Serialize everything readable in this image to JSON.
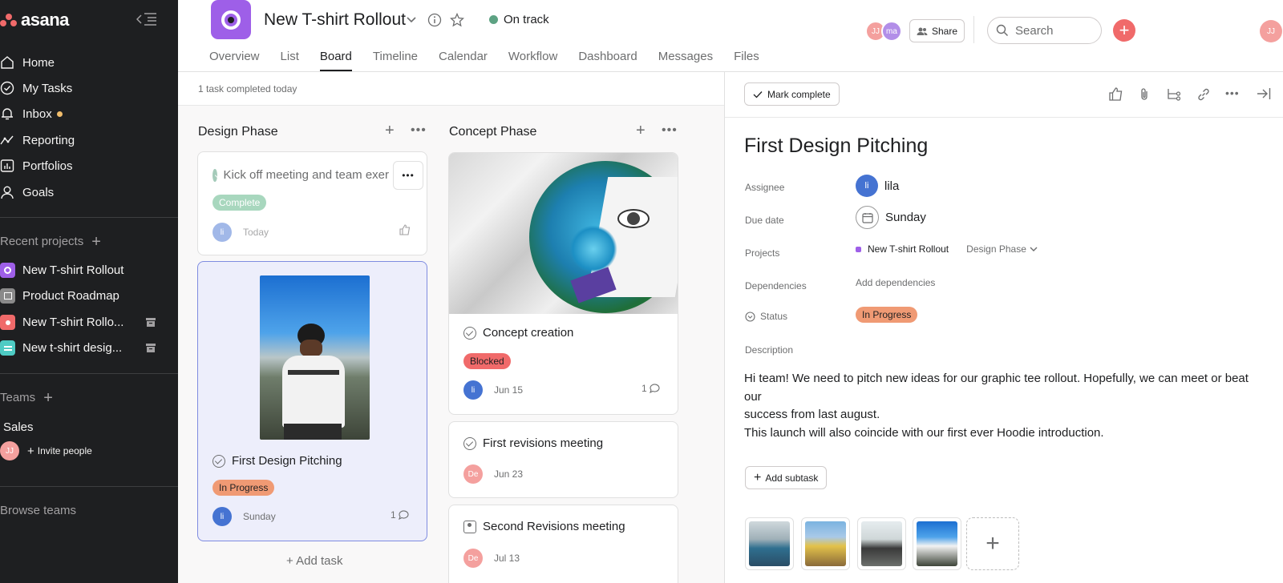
{
  "sidebar": {
    "logo_text": "asana",
    "nav": [
      {
        "label": "Home",
        "icon": "home-icon"
      },
      {
        "label": "My Tasks",
        "icon": "check-circle-icon"
      },
      {
        "label": "Inbox",
        "icon": "bell-icon"
      },
      {
        "label": "Reporting",
        "icon": "trend-icon"
      },
      {
        "label": "Portfolios",
        "icon": "bar-chart-icon"
      },
      {
        "label": "Goals",
        "icon": "person-icon"
      }
    ],
    "recent_projects_title": "Recent projects",
    "projects": [
      {
        "label": "New T-shirt Rollout",
        "color": "#9e5fe8"
      },
      {
        "label": "Product Roadmap",
        "color": "#8a8a8a"
      },
      {
        "label": "New T-shirt Rollo...",
        "color": "#f06a6a"
      },
      {
        "label": "New t-shirt desig...",
        "color": "#4ecbc4"
      }
    ],
    "teams_title": "Teams",
    "team_name": "Sales",
    "team_avatar": "JJ",
    "invite_label": "Invite people",
    "browse_label": "Browse teams"
  },
  "header": {
    "project_title": "New T-shirt Rollout",
    "status": "On track",
    "tabs": [
      "Overview",
      "List",
      "Board",
      "Timeline",
      "Calendar",
      "Workflow",
      "Dashboard",
      "Messages",
      "Files"
    ],
    "active_tab": "Board",
    "member_avatars": [
      "JJ",
      "ma"
    ],
    "share_label": "Share",
    "search_placeholder": "Search",
    "user_avatar": "JJ"
  },
  "board": {
    "summary": "1 task completed today",
    "columns": [
      {
        "title": "Design Phase",
        "cards": [
          {
            "title": "Kick off meeting and team exer",
            "tag": "Complete",
            "assignee": "li",
            "date": "Today"
          },
          {
            "title": "First Design Pitching",
            "tag": "In Progress",
            "assignee": "li",
            "date": "Sunday",
            "comments": "1"
          }
        ],
        "add_task": "Add task"
      },
      {
        "title": "Concept Phase",
        "cards": [
          {
            "title": "Concept creation",
            "tag": "Blocked",
            "assignee": "li",
            "date": "Jun 15",
            "comments": "1"
          },
          {
            "title": "First revisions meeting",
            "assignee": "De",
            "date": "Jun 23"
          },
          {
            "title": "Second Revisions meeting",
            "assignee": "De",
            "date": "Jul 13"
          }
        ]
      }
    ]
  },
  "task": {
    "mark_complete": "Mark complete",
    "title": "First Design Pitching",
    "fields": {
      "assignee_label": "Assignee",
      "assignee_value": "lila",
      "assignee_avatar": "li",
      "due_label": "Due date",
      "due_value": "Sunday",
      "projects_label": "Projects",
      "project_value": "New T-shirt Rollout",
      "section_value": "Design Phase",
      "dependencies_label": "Dependencies",
      "dependencies_value": "Add dependencies",
      "status_label": "Status",
      "status_value": "In Progress",
      "description_label": "Description"
    },
    "description_lines": [
      "Hi team! We need to pitch new ideas for our graphic tee rollout. Hopefully, we can meet or beat our",
      "success from last august.",
      "This launch will also coincide with our first ever Hoodie introduction."
    ],
    "add_subtask": "Add subtask"
  },
  "colors": {
    "sidebar_bg": "#1e1f21",
    "accent_red": "#f06a6a",
    "project_purple": "#9e5fe8",
    "on_track": "#5da283",
    "in_progress": "#f09a74",
    "blue_avatar": "#4573d2"
  }
}
